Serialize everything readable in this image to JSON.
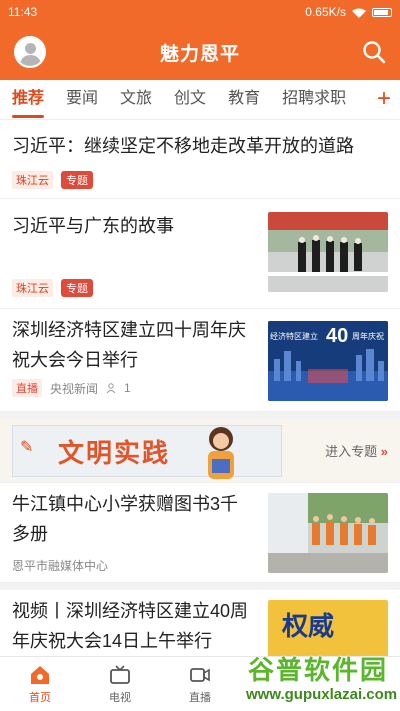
{
  "status": {
    "time": "11:43",
    "speed": "0.65K/s"
  },
  "header": {
    "title": "魅力恩平"
  },
  "tabs": [
    "推荐",
    "要闻",
    "文旅",
    "创文",
    "教育",
    "招聘求职"
  ],
  "tab_add": "+",
  "feed": {
    "item1": {
      "title": "习近平：继续坚定不移地走改革开放的道路",
      "source": "珠江云",
      "topic": "专题"
    },
    "item2": {
      "title": "习近平与广东的故事",
      "source": "珠江云",
      "topic": "专题"
    },
    "item3": {
      "title": "深圳经济特区建立四十周年庆祝大会今日举行",
      "live": "直播",
      "source": "央视新闻",
      "count": "1",
      "thumb_text": "经济特区建立",
      "thumb_num": "40",
      "thumb_suffix": "周年庆祝"
    },
    "banner": {
      "text": "文明实践",
      "enter": "进入专题",
      "arrow": "»"
    },
    "item4": {
      "title": "牛江镇中心小学获赠图书3千多册",
      "source": "恩平市融媒体中心"
    },
    "item5": {
      "title": "视频丨深圳经济特区建立40周年庆祝大会14日上午举行",
      "thumb_text": "权威"
    }
  },
  "bottom_nav": [
    {
      "label": "首页"
    },
    {
      "label": "电视"
    },
    {
      "label": "直播"
    }
  ],
  "watermark": {
    "text1": "谷普软件园",
    "text2": "www.gupuxlazai.com"
  },
  "colors": {
    "brand": "#f26a2a",
    "accent": "#e04a1a"
  }
}
